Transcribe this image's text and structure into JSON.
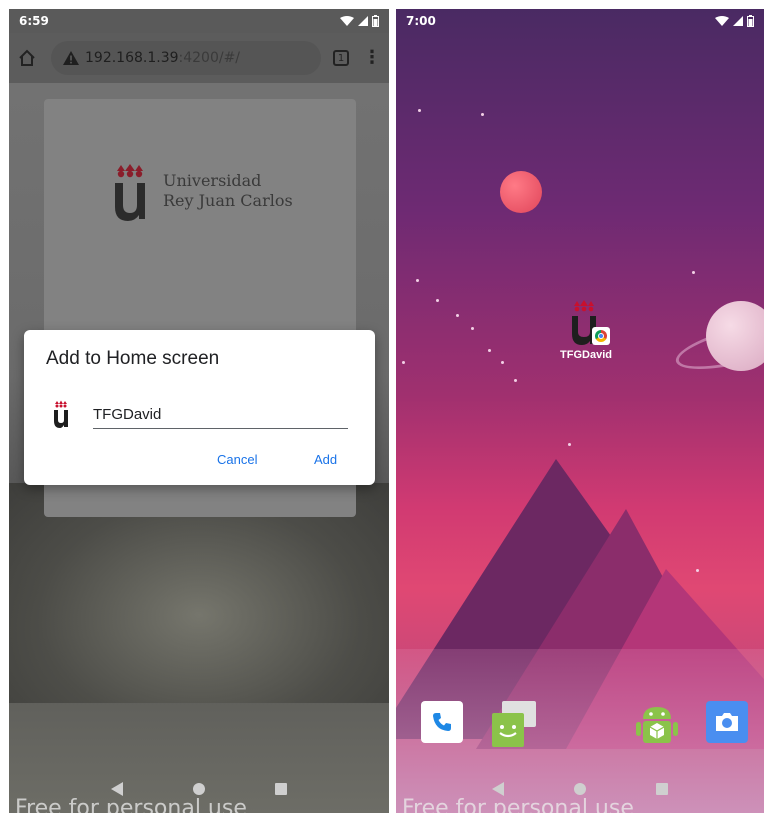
{
  "left_screen": {
    "status_time": "6:59",
    "url_host": "192.168.1.39",
    "url_rest": ":4200/#/",
    "tab_count": "1",
    "logo_line1": "Universidad",
    "logo_line2": "Rey Juan Carlos",
    "dialog": {
      "title": "Add to Home screen",
      "input_value": "TFGDavid",
      "cancel_label": "Cancel",
      "add_label": "Add"
    },
    "watermark": "Free for personal use"
  },
  "right_screen": {
    "status_time": "7:00",
    "shortcut_label": "TFGDavid",
    "watermark": "Free for personal use"
  },
  "colors": {
    "dialog_button": "#1a73e8",
    "urjc_red": "#c8102e",
    "urjc_dark": "#2b2b2b"
  }
}
